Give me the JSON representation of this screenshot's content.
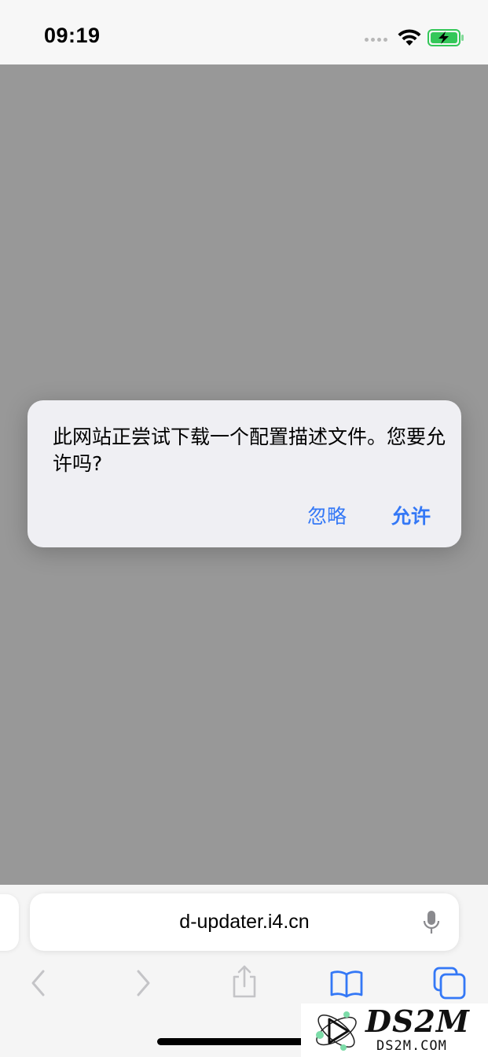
{
  "status_bar": {
    "time": "09:19",
    "icons": [
      "signal-dots-icon",
      "wifi-icon",
      "battery-charging-icon"
    ],
    "battery_color": "#34c759"
  },
  "alert": {
    "message": "此网站正尝试下载一个配置描述文件。您要允许吗?",
    "ignore_label": "忽略",
    "allow_label": "允许",
    "button_color": "#3478f6"
  },
  "address_bar": {
    "url": "d-updater.i4.cn",
    "mic_icon": "microphone-icon"
  },
  "toolbar": {
    "icons": [
      "back-icon",
      "forward-icon",
      "share-icon",
      "bookmarks-icon",
      "tabs-icon"
    ],
    "accent_color": "#3478f6"
  },
  "watermark": {
    "title": "DS2M",
    "subtitle": "DS2M.COM"
  }
}
